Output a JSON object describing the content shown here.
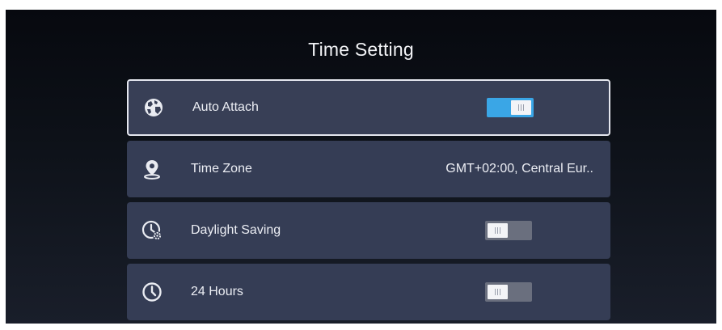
{
  "title": "Time Setting",
  "rows": [
    {
      "label": "Auto Attach",
      "icon": "globe-icon",
      "control": "toggle",
      "on": true,
      "focused": true
    },
    {
      "label": "Time Zone",
      "icon": "location-pin-icon",
      "control": "value",
      "value": "GMT+02:00, Central Eur.."
    },
    {
      "label": "Daylight Saving",
      "icon": "clock-gear-icon",
      "control": "toggle",
      "on": false
    },
    {
      "label": "24 Hours",
      "icon": "clock-icon",
      "control": "toggle",
      "on": false
    }
  ],
  "colors": {
    "toggle_on": "#3aa6e6",
    "toggle_off": "#6a6f7e",
    "row_background": "#353d55",
    "focus_border": "#e4e6ee"
  }
}
